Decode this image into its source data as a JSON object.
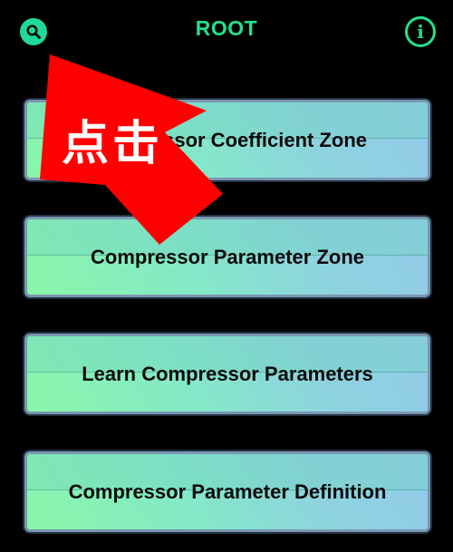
{
  "header": {
    "title": "ROOT",
    "search_icon": "search-icon",
    "info_icon": "info-icon",
    "info_glyph": "i"
  },
  "menu": {
    "items": [
      {
        "label": "Compressor Coefficient Zone"
      },
      {
        "label": "Compressor Parameter Zone"
      },
      {
        "label": "Learn Compressor Parameters"
      },
      {
        "label": "Compressor Parameter Definition"
      }
    ]
  },
  "overlay": {
    "text": "点击",
    "arrow_color": "#ff0000"
  },
  "colors": {
    "accent": "#22e08f",
    "background": "#000000",
    "button_border": "#7a96b0"
  }
}
